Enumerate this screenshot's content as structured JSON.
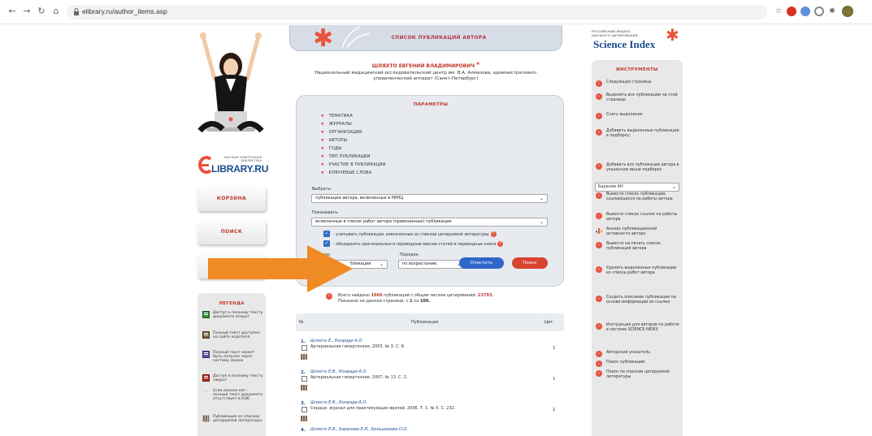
{
  "browser": {
    "url": "elibrary.ru/author_items.asp"
  },
  "left": {
    "logo_small": "НАУЧНАЯ ЭЛЕКТРОННАЯ БИБЛИОТЕКА",
    "logo_big": "LIBRARY.RU",
    "buttons": [
      "КОРЗИНА",
      "ПОИСК",
      ""
    ],
    "legend_title": "ЛЕГЕНДА",
    "legend_items": [
      "Доступ к полному тексту документа открыт",
      "Полный текст доступен на сайте издателя",
      "Полный текст может быть получен через систему заказа",
      "Доступ к полному тексту закрыт",
      "Если иконки нет - полный текст документа отсутствует в НЭБ",
      "Публикация из списков цитируемой литературы"
    ]
  },
  "center": {
    "title": "СПИСОК ПУБЛИКАЦИЙ АВТОРА",
    "author_name": "ШЛЯХТО ЕВГЕНИЙ ВЛАДИМИРОВИЧ",
    "author_org": "Национальный медицинский исследовательский центр им. В.А. Алмазова, административно-управленческий аппарат (Санкт-Петербург)",
    "params_title": "ПАРАМЕТРЫ",
    "filters": [
      "ТЕМАТИКА",
      "ЖУРНАЛЫ",
      "ОРГАНИЗАЦИИ",
      "АВТОРЫ",
      "ГОДЫ",
      "ТИП ПУБЛИКАЦИИ",
      "УЧАСТИЕ В ПУБЛИКАЦИИ",
      "КЛЮЧЕВЫЕ СЛОВА"
    ],
    "select_label_1": "Выбрать:",
    "select_value_1": "публикации автора, включенные в РИНЦ",
    "select_label_2": "Показывать:",
    "select_value_2": "включенные в список работ автора (привязанные) публикации",
    "check_1": "- учитывать публикации, извлеченные из списков цитируемой литературы",
    "check_2": "- объединять оригинальные и переводные версии статей и переводные книги",
    "sort_label": "Сортиро",
    "sort_value": "бликации",
    "order_label": "Порядок:",
    "order_value": "по возрастанию",
    "btn_clear": "Очистить",
    "btn_search": "Поиск",
    "found_line_1_prefix": "Всего найдено",
    "found_count": "1060",
    "found_line_1_mid": "публикаций с общим числом цитирований:",
    "found_citations": "23793.",
    "found_line_2": "Показано на данной странице: с",
    "found_from": "1",
    "found_to_word": "по",
    "found_to": "100.",
    "table_col_num": "№",
    "table_col_pub": "Публикация",
    "table_col_cit": "Цит.",
    "rows": [
      {
        "n": "1.",
        "authors": "Шляхто Е., Конради А.О.",
        "source": "Артериальная гипертензия. 2003. № 3. С. 6.",
        "cit": "1"
      },
      {
        "n": "2.",
        "authors": "Шляхто Е.В., Конради А.О.",
        "source": "Артериальная гипертензия. 2007. № 13. С. 2.",
        "cit": "1"
      },
      {
        "n": "3.",
        "authors": "Шляхто Е.В., Конради А.О.",
        "source": "Сердце: журнал для практикующих врачей. 2006. Т. 1. № 5. С. 232.",
        "cit": "1"
      },
      {
        "n": "4.",
        "authors": "Шляхто Е.В., Баранова Е.И., Большакова О.О.",
        "source": "",
        "cit": ""
      }
    ]
  },
  "right": {
    "si_small": "РОССИЙСКИЙ ИНДЕКС НАУЧНОГО ЦИТИРОВАНИЯ",
    "si_big": "Science Index",
    "tools_title": "ИНСТРУМЕНТЫ",
    "tools": [
      "Следующая страница",
      "Выделить все публикации на этой странице",
      "Снять выделение",
      "Добавить выделенные публикации в подборку:",
      "Добавить все публикации автора в указанную выше подборку",
      "Вывести список публикаций, ссылающихся на работы автора",
      "Вывести список ссылок на работы автора",
      "Анализ публикационной активности автора",
      "Вывести на печать список публикаций автора",
      "Удалить выделенные публикации из списка работ автора",
      "Создать описание публикации на основе информации из ссылки",
      "Инструкция для авторов по работе в системе SCIENCE INDEX",
      "Авторский указатель",
      "Поиск публикаций",
      "Поиск по спискам цитируемой литературы"
    ],
    "select_value": "Баранов АН"
  },
  "colors": {
    "accent_red": "#c0392b",
    "button_blue": "#2f67c9",
    "button_red": "#d9432f",
    "arrow_orange": "#f08a24"
  }
}
